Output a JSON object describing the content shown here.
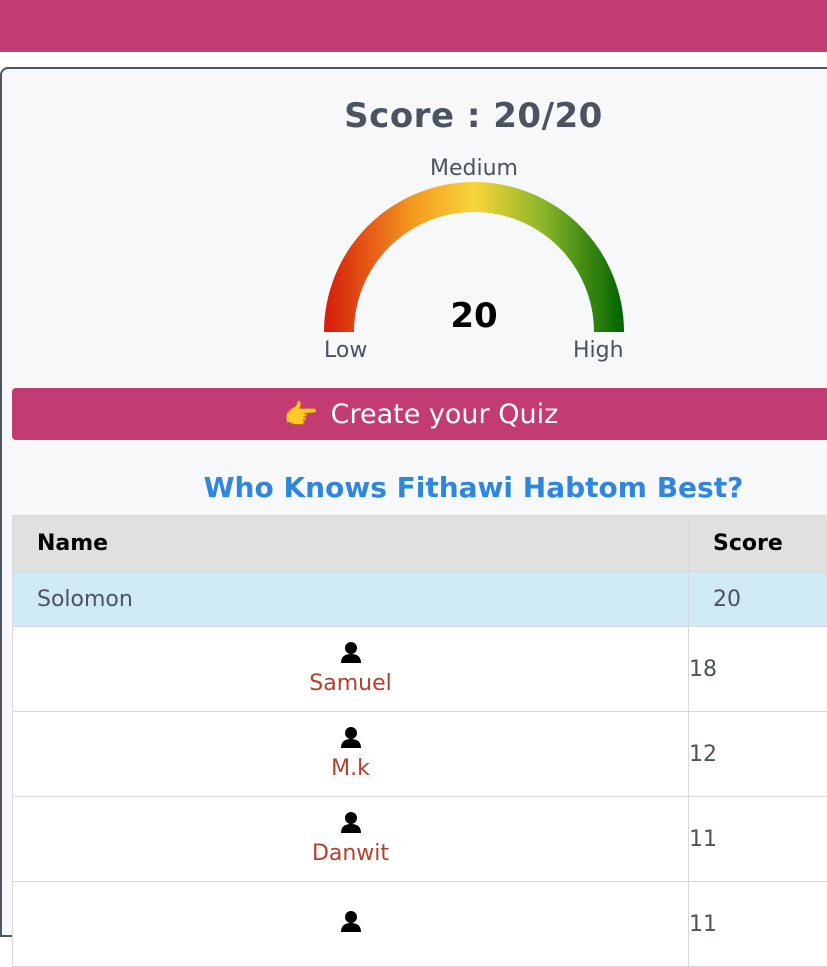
{
  "result": {
    "score_text": "Score : 20/20",
    "gauge": {
      "medium_label": "Medium",
      "low_label": "Low",
      "high_label": "High",
      "value": "20",
      "max": 20,
      "colors": [
        "#d61a0c",
        "#f39b20",
        "#f8d53a",
        "#8fb82a",
        "#006400"
      ]
    }
  },
  "create_quiz": {
    "icon": "pointing-hand-icon",
    "label": "Create your Quiz"
  },
  "leaderboard": {
    "title": "Who Knows Fithawi Habtom Best?",
    "columns": {
      "name": "Name",
      "score": "Score"
    },
    "highlight_row": {
      "name": "Solomon",
      "score": "20"
    },
    "rows": [
      {
        "icon": "user-icon",
        "name": "Samuel",
        "score": "18"
      },
      {
        "icon": "user-icon",
        "name": "M.k",
        "score": "12"
      },
      {
        "icon": "user-icon",
        "name": "Danwit",
        "score": "11"
      },
      {
        "icon": "user-icon",
        "name": "",
        "score": "11"
      }
    ]
  },
  "theme": {
    "brand": "#c23b72",
    "link": "#2e86de",
    "player_name": "#b53f2a"
  }
}
